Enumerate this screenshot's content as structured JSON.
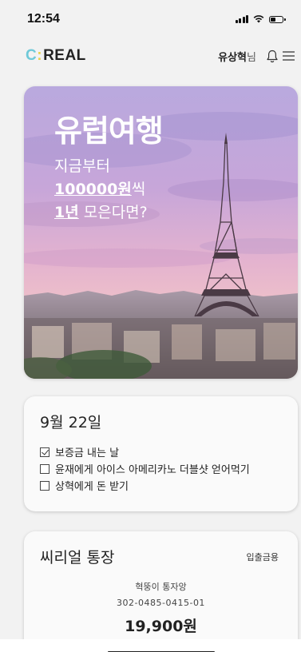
{
  "status": {
    "time": "12:54"
  },
  "header": {
    "logo": {
      "c": "C",
      "colon": ":",
      "rest": "REAL"
    },
    "user_name": "유상혁",
    "user_suffix": "님",
    "icons": [
      "bell-icon",
      "menu-icon"
    ]
  },
  "hero": {
    "title": "유럽여행",
    "line1": "지금부터",
    "amount": "100000원",
    "amount_suffix": "씩",
    "period": "1년",
    "period_suffix": " 모은다면?",
    "image": "eiffel-tower-paris-sunset"
  },
  "date_card": {
    "title": "9월 22일",
    "items": [
      {
        "label": "보증금 내는 날",
        "checked": true
      },
      {
        "label": "윤재에게 아이스 아메리카노 더블샷 얻어먹기",
        "checked": false
      },
      {
        "label": "상혁에게 돈 받기",
        "checked": false
      }
    ]
  },
  "account_card": {
    "title": "씨리얼 통장",
    "link": "입출금용",
    "name": "혁뚱이 통자앙",
    "number": "302-0485-0415-01",
    "balance": "19,900원"
  }
}
